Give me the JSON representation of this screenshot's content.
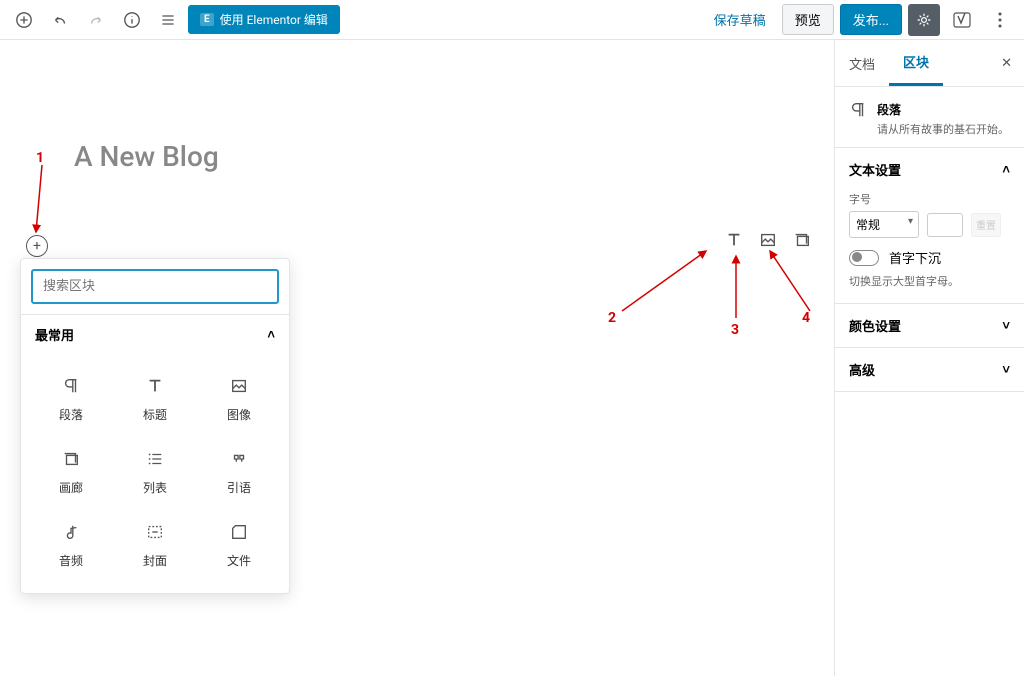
{
  "topbar": {
    "elementor_label": "使用 Elementor 编辑",
    "save_draft": "保存草稿",
    "preview": "预览",
    "publish": "发布..."
  },
  "editor": {
    "title": "A New Blog",
    "block_search_placeholder": "搜索区块",
    "common_label": "最常用",
    "blocks": [
      {
        "label": "段落",
        "icon": "paragraph"
      },
      {
        "label": "标题",
        "icon": "heading"
      },
      {
        "label": "图像",
        "icon": "image"
      },
      {
        "label": "画廊",
        "icon": "gallery"
      },
      {
        "label": "列表",
        "icon": "list"
      },
      {
        "label": "引语",
        "icon": "quote"
      },
      {
        "label": "音频",
        "icon": "audio"
      },
      {
        "label": "封面",
        "icon": "cover"
      },
      {
        "label": "文件",
        "icon": "file"
      }
    ]
  },
  "annotations": {
    "n1": "1",
    "n2": "2",
    "n3": "3",
    "n4": "4"
  },
  "sidebar": {
    "tab_doc": "文档",
    "tab_block": "区块",
    "block_title": "段落",
    "block_desc": "请从所有故事的基石开始。",
    "text_settings": "文本设置",
    "font_size_label": "字号",
    "font_size_value": "常规",
    "reset_label": "重置",
    "dropcap_label": "首字下沉",
    "dropcap_hint": "切换显示大型首字母。",
    "color_settings": "颜色设置",
    "advanced": "高级"
  }
}
